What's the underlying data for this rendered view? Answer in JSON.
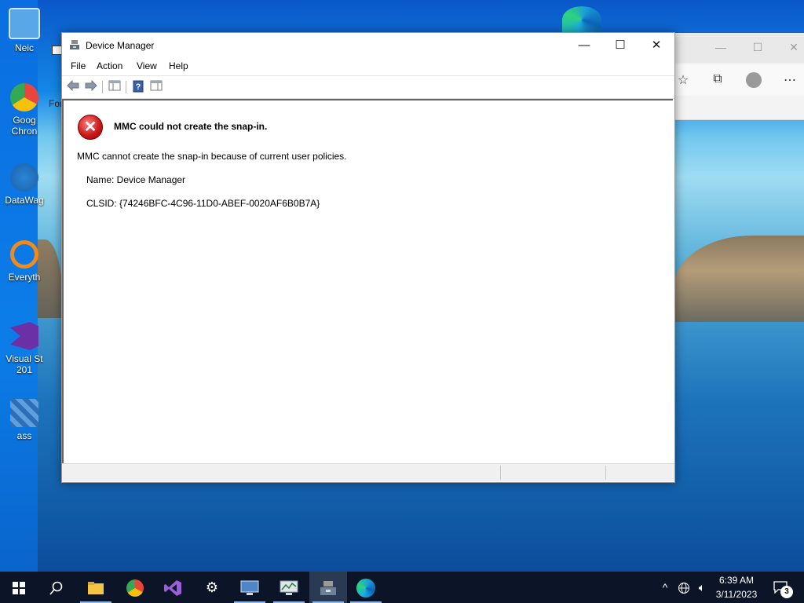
{
  "desktop": {
    "icons": [
      {
        "label": "Neic",
        "color": "#5aa7e8"
      },
      {
        "label": "Goog Chron",
        "color": "#e8453c"
      },
      {
        "label": "DataWag",
        "color": "#2a86d6"
      },
      {
        "label": "Everyth",
        "color": "#f08a1a"
      },
      {
        "label": "Visual St 201",
        "color": "#6b2fa6"
      },
      {
        "label": "ass",
        "color": "#2c6fb4"
      }
    ]
  },
  "edge": {
    "partial_tab_text": "For",
    "icons": [
      "favorites-icon",
      "collections-icon",
      "profile-icon",
      "more-icon"
    ],
    "window_controls": [
      "—",
      "☐",
      "✕"
    ]
  },
  "window": {
    "title": "Device Manager",
    "controls": {
      "minimize": "—",
      "maximize": "☐",
      "close": "✕"
    },
    "menu": [
      "File",
      "Action",
      "View",
      "Help"
    ],
    "toolbar": [
      "back-icon",
      "forward-icon",
      "console-tree-icon",
      "help-icon",
      "action-pane-icon"
    ]
  },
  "error": {
    "heading": "MMC could not create the snap-in.",
    "message": "MMC cannot create the snap-in because of current user policies.",
    "name_line": "Name: Device Manager",
    "clsid_line": "CLSID: {74246BFC-4C96-11D0-ABEF-0020AF6B0B7A}"
  },
  "taskbar": {
    "apps": [
      "start-icon",
      "search-icon",
      "file-explorer-icon",
      "chrome-icon",
      "visual-studio-icon",
      "settings-icon",
      "remote-desktop-icon",
      "performance-monitor-icon",
      "device-manager-icon",
      "edge-icon"
    ],
    "active_app": "device-manager-icon",
    "tray": [
      "chevron-up-icon",
      "network-icon",
      "volume-icon"
    ],
    "time": "6:39 AM",
    "date": "3/11/2023",
    "notification_count": "3"
  }
}
